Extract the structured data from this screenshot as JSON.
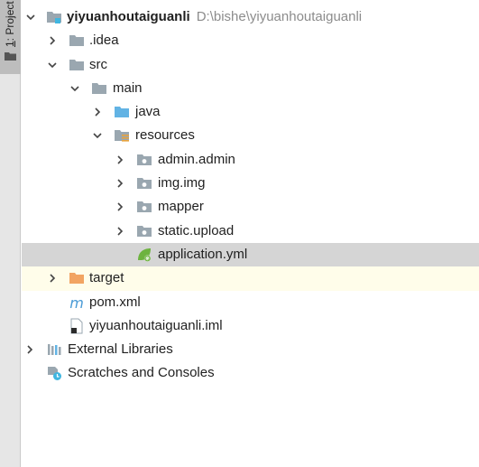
{
  "side_panel": {
    "tab_number": "1",
    "tab_label": ": Project"
  },
  "tree": {
    "root": {
      "name": "yiyuanhoutaiguanli",
      "path": "D:\\bishe\\yiyuanhoutaiguanli"
    },
    "idea": "idea",
    "src": "src",
    "main": "main",
    "java": "java",
    "resources": "resources",
    "admin": "admin.admin",
    "img": "img.img",
    "mapper": "mapper",
    "static_upload": "static.upload",
    "application_yml": "application.yml",
    "target": "target",
    "pom": "pom.xml",
    "iml": "yiyuanhoutaiguanli.iml",
    "external_libraries": "External Libraries",
    "scratches": "Scratches and Consoles"
  },
  "colors": {
    "selected_row": "#d5d5d5",
    "excluded_row": "#fffdea",
    "folder": "#9aa7b0",
    "source_folder": "#62b3e4",
    "excluded_folder": "#f2a462",
    "spring": "#6db33f"
  }
}
